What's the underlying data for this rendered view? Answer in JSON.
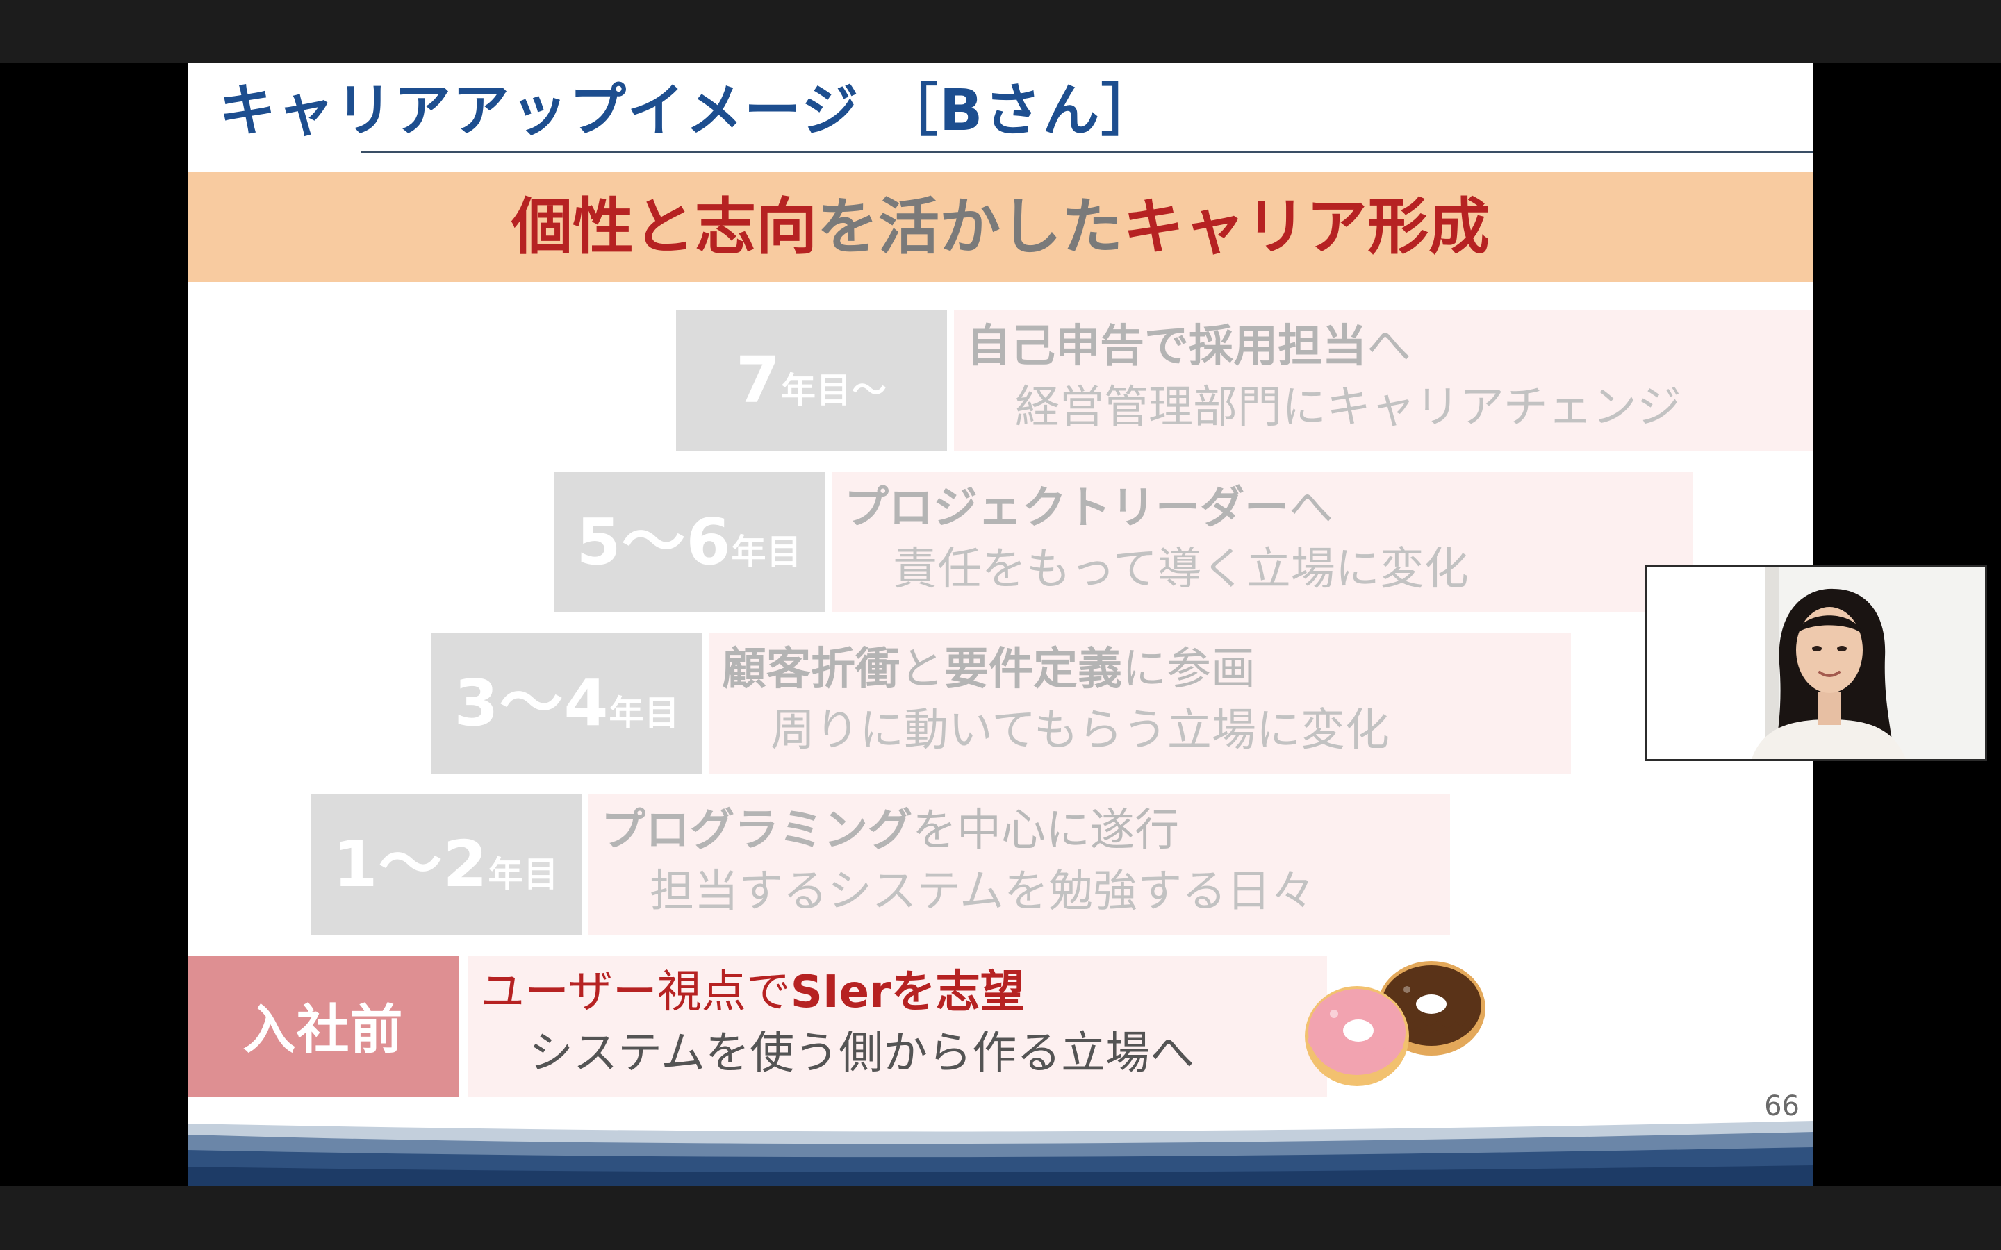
{
  "slide": {
    "title": "キャリアアップイメージ ［Bさん］",
    "banner": {
      "part1": "個性と志向",
      "part2": "を活かした",
      "part3": "キャリア形成"
    },
    "page_number": "66",
    "steps": [
      {
        "year_main": "7",
        "year_suffix": "年目～",
        "line1_em": "自己申告で採用担当",
        "line1_rest": "へ",
        "line2": "経営管理部門にキャリアチェンジ"
      },
      {
        "year_main": "5～6",
        "year_suffix": "年目",
        "line1_em": "プロジェクトリーダー",
        "line1_rest": "へ",
        "line2": "責任をもって導く立場に変化"
      },
      {
        "year_main": "3～4",
        "year_suffix": "年目",
        "line1_em": "顧客折衝",
        "line1_mid": "と",
        "line1_em2": "要件定義",
        "line1_rest": "に参画",
        "line2": "周りに動いてもらう立場に変化"
      },
      {
        "year_main": "1～2",
        "year_suffix": "年目",
        "line1_em": "プログラミング",
        "line1_rest": "を中心に遂行",
        "line2": "担当するシステムを勉強する日々"
      },
      {
        "label": "入社前",
        "line1_plain": "ユーザー視点で",
        "line1_em": "SIerを志望",
        "line2": "システムを使う側から作る立場へ"
      }
    ],
    "decoration_icon": "donut-icon"
  },
  "video": {
    "participant_icon": "participant-video"
  },
  "colors": {
    "title_blue": "#1d4e8f",
    "banner_bg": "#f8cba0",
    "accent_red": "#b62222",
    "year_gray": "#dcdcdc",
    "current_step_red": "#de8f92",
    "desc_bg": "#fdf0f0"
  }
}
